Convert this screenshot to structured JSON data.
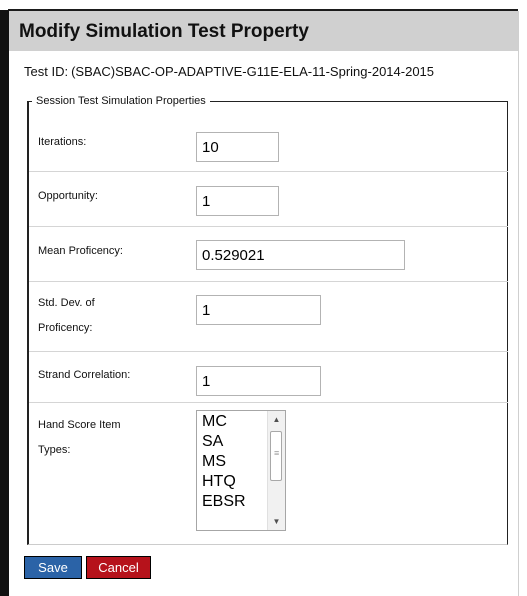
{
  "dialog": {
    "title": "Modify Simulation Test Property",
    "test_id_label": "Test ID:",
    "test_id_value": "(SBAC)SBAC-OP-ADAPTIVE-G11E-ELA-11-Spring-2014-2015"
  },
  "properties": {
    "legend": "Session Test Simulation Properties",
    "iterations": {
      "label": "Iterations:",
      "value": "10"
    },
    "opportunity": {
      "label": "Opportunity:",
      "value": "1"
    },
    "mean_proficiency": {
      "label": "Mean Proficency:",
      "value": "0.529021"
    },
    "std_dev": {
      "label_line1": "Std. Dev. of",
      "label_line2": "Proficency:",
      "value": "1"
    },
    "strand_correlation": {
      "label": "Strand Correlation:",
      "value": "1"
    },
    "hand_score": {
      "label_line1": "Hand Score Item",
      "label_line2": "Types:",
      "options": [
        "MC",
        "SA",
        "MS",
        "HTQ",
        "EBSR"
      ]
    }
  },
  "buttons": {
    "save": "Save",
    "cancel": "Cancel"
  },
  "colors": {
    "title_bar": "#d0d0d0",
    "save_button": "#2b63a7",
    "cancel_button": "#b6121b"
  },
  "icons": {
    "scroll_up": "triangle-up",
    "scroll_down": "triangle-down",
    "scroll_thumb": "grip-lines"
  }
}
